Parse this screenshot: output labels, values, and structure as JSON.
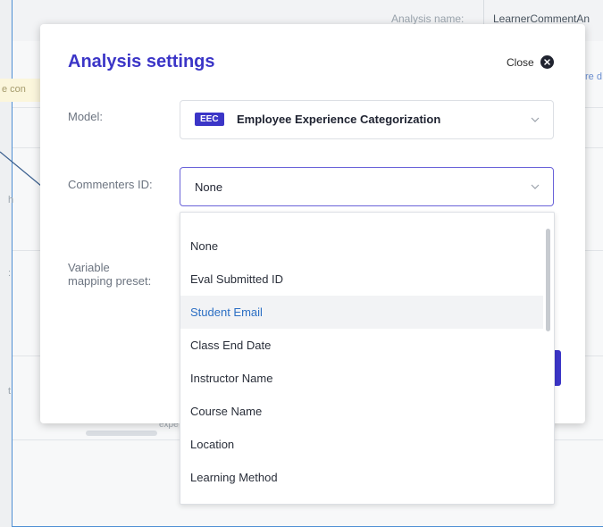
{
  "background": {
    "analysis_name_label": "Analysis name:",
    "analysis_name_value": "LearnerCommentAn",
    "yellow_notice_fragment": "e con",
    "link_fragment": "re d",
    "expe_fragment": "expe"
  },
  "modal": {
    "title": "Analysis settings",
    "close_label": "Close",
    "model_label": "Model:",
    "model_badge": "EEC",
    "model_value": "Employee Experience Categorization",
    "commenters_label": "Commenters ID:",
    "commenters_value": "None",
    "variable_label_line1": "Variable",
    "variable_label_line2": "mapping preset:"
  },
  "dropdown": {
    "options": [
      "None",
      "Eval Submitted ID",
      "Student Email",
      "Class End Date",
      "Instructor Name",
      "Course Name",
      "Location",
      "Learning Method"
    ],
    "highlighted": "Student Email"
  },
  "colors": {
    "accent": "#3b35c7",
    "frame": "#4e8fd4",
    "highlight_text": "#2c6fc4"
  }
}
